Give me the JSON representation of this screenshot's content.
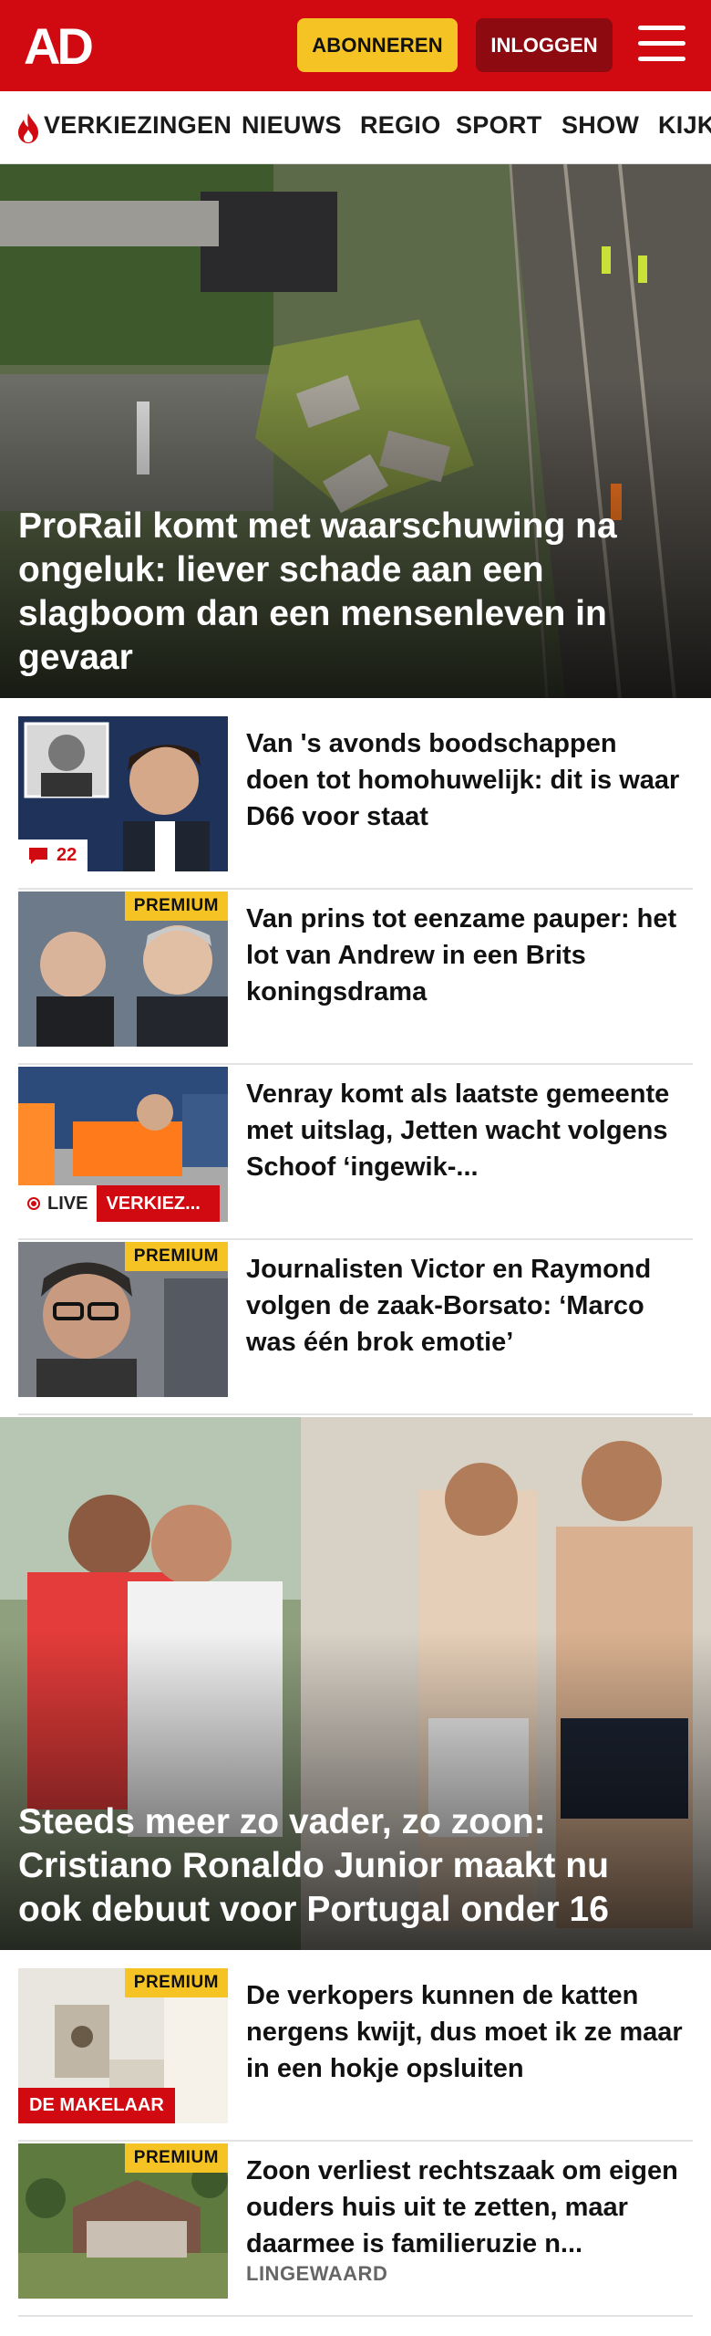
{
  "header": {
    "logo": "AD",
    "subscribe_label": "ABONNEREN",
    "login_label": "INLOGGEN",
    "menu_icon": "hamburger-icon",
    "brand_color": "#d10a11",
    "accent_color": "#f5c424"
  },
  "nav": {
    "items": [
      {
        "label": "VERKIEZINGEN",
        "icon": "flame-icon"
      },
      {
        "label": "NIEUWS"
      },
      {
        "label": "REGIO"
      },
      {
        "label": "SPORT"
      },
      {
        "label": "SHOW"
      },
      {
        "label": "KIJK"
      }
    ]
  },
  "hero1": {
    "title": "ProRail komt met waarschuwing na ongeluk: liever schade aan een slagboom dan een mensenleven in gevaar"
  },
  "articles": [
    {
      "headline": "Van 's avonds boodschappen doen tot homohuwelijk: dit is waar D66 voor staat",
      "comments": "22"
    },
    {
      "headline": "Van prins tot eenzame pauper: het lot van Andrew in een Brits koningsdrama",
      "badge": "PREMIUM"
    },
    {
      "headline": "Venray komt als laatste gemeente met uitslag, Jetten wacht volgens Schoof ‘ingewik-...",
      "live": "LIVE",
      "category": "VERKIEZ..."
    },
    {
      "headline": "Journalisten Victor en Raymond volgen de zaak-Borsato: ‘Marco was één brok emotie’",
      "badge": "PREMIUM"
    }
  ],
  "hero2": {
    "title": "Steeds meer zo vader, zo zoon: Cristiano Ronaldo Junior maakt nu ook debuut voor Portugal onder 16"
  },
  "articles2": [
    {
      "headline": "De verkopers kunnen de katten nergens kwijt, dus moet ik ze maar in een hokje opsluiten",
      "badge": "PREMIUM",
      "section": "DE MAKELAAR"
    },
    {
      "headline": "Zoon verliest rechtszaak om eigen ouders huis uit te zetten, maar daarmee is familieruzie n...",
      "badge": "PREMIUM",
      "tag": "LINGEWAARD"
    }
  ]
}
